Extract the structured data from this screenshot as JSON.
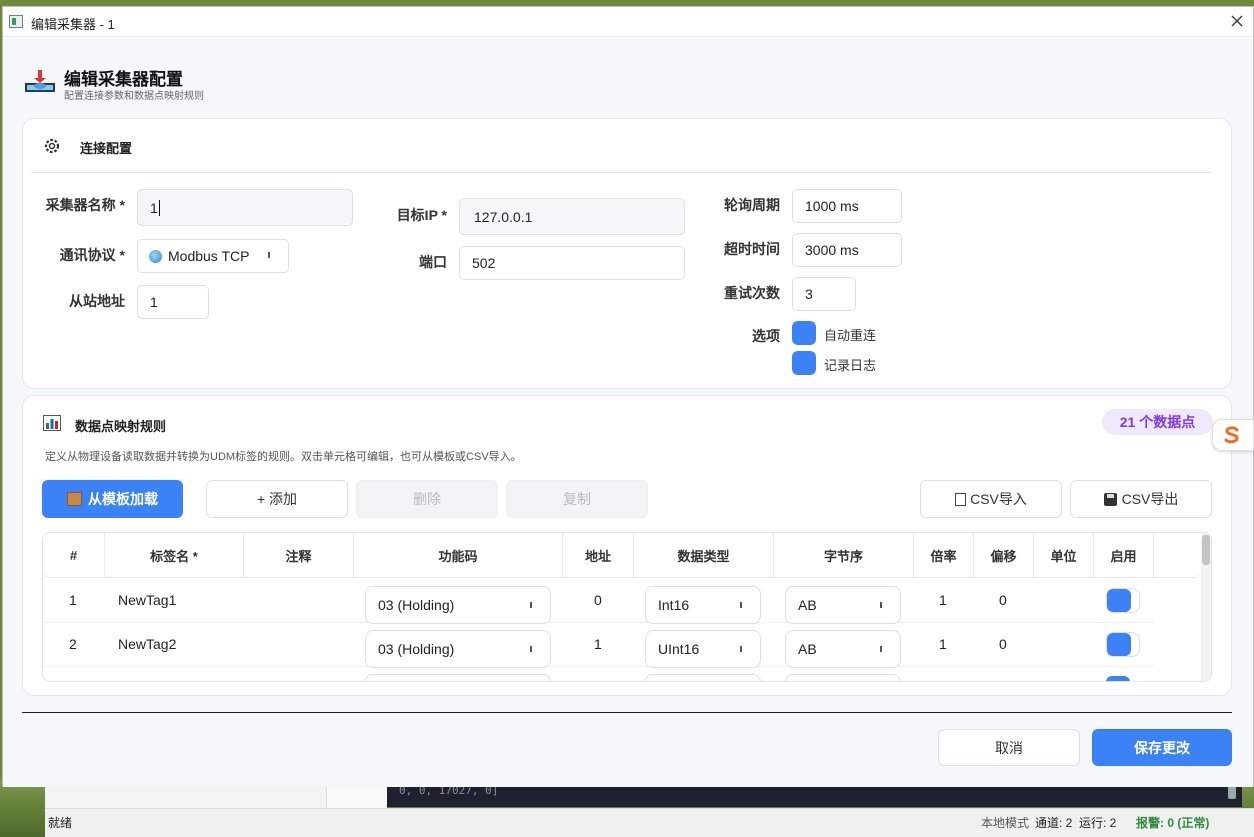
{
  "window": {
    "title": "编辑采集器 - 1"
  },
  "header": {
    "title": "编辑采集器配置",
    "subtitle": "配置连接参数和数据点映射规则"
  },
  "connection": {
    "section_title": "连接配置",
    "name_label": "采集器名称 *",
    "name_value": "1",
    "protocol_label": "通讯协议 *",
    "protocol_value": "Modbus TCP",
    "slave_label": "从站地址",
    "slave_value": "1",
    "ip_label": "目标IP *",
    "ip_value": "127.0.0.1",
    "port_label": "端口",
    "port_value": "502",
    "poll_label": "轮询周期",
    "poll_value": "1000 ms",
    "timeout_label": "超时时间",
    "timeout_value": "3000 ms",
    "retry_label": "重试次数",
    "retry_value": "3",
    "options_label": "选项",
    "opt_reconnect": "自动重连",
    "opt_log": "记录日志"
  },
  "mapping": {
    "section_title": "数据点映射规则",
    "count_badge": "21 个数据点",
    "description": "定义从物理设备读取数据并转换为UDM标签的规则。双击单元格可编辑，也可从模板或CSV导入。",
    "load_template": "从模板加载",
    "add": "+ 添加",
    "delete": "删除",
    "copy": "复制",
    "csv_import": "CSV导入",
    "csv_export": "CSV导出",
    "columns": [
      "#",
      "标签名 *",
      "注释",
      "功能码",
      "地址",
      "数据类型",
      "字节序",
      "倍率",
      "偏移",
      "单位",
      "启用"
    ],
    "rows": [
      {
        "idx": "1",
        "name": "NewTag1",
        "comment": "",
        "fc": "03 (Holding)",
        "addr": "0",
        "dtype": "Int16",
        "order": "AB",
        "scale": "1",
        "offset": "0",
        "unit": "",
        "enabled": true
      },
      {
        "idx": "2",
        "name": "NewTag2",
        "comment": "",
        "fc": "03 (Holding)",
        "addr": "1",
        "dtype": "UInt16",
        "order": "AB",
        "scale": "1",
        "offset": "0",
        "unit": "",
        "enabled": true
      }
    ]
  },
  "footer": {
    "cancel": "取消",
    "save": "保存更改"
  },
  "background": {
    "terminal_text": "0, 0, 17027, 0]",
    "status_left": "就绪",
    "status_mode": "本地模式",
    "status_channels": "通道: 2",
    "status_running": "运行: 2",
    "status_alarm": "报警: 0 (正常)"
  },
  "colors": {
    "accent": "#3b82f6",
    "badge_bg": "#efe9fb",
    "badge_text": "#7c3aed",
    "alarm": "#2e8b3a"
  }
}
